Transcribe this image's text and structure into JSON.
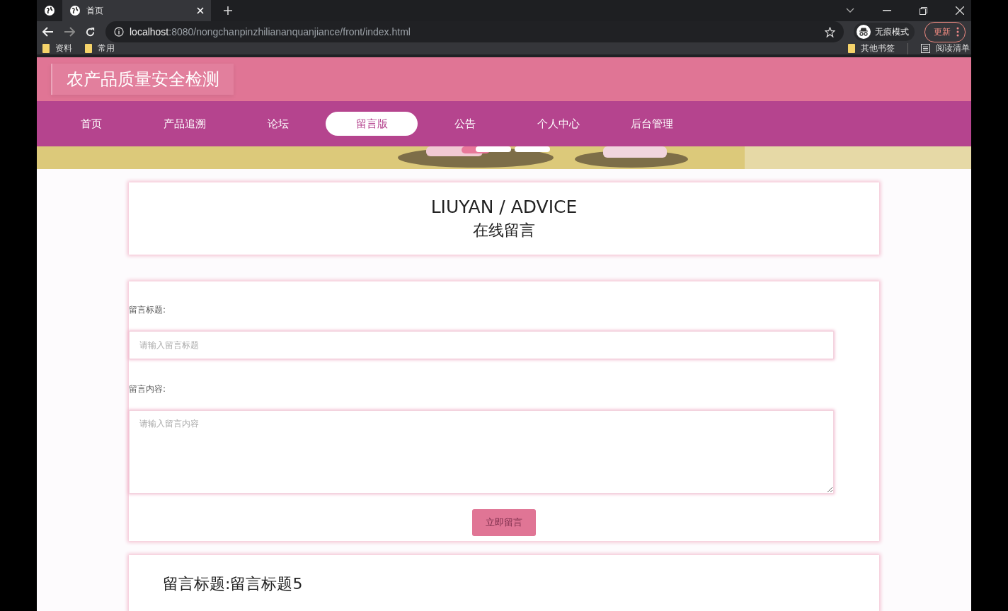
{
  "browser": {
    "tabs": [
      {
        "title": "首页",
        "selected": true
      }
    ],
    "url_host": "localhost",
    "url_path": ":8080/nongchanpinzhiliananquanjiance/front/index.html",
    "incognito_label": "无痕模式",
    "update_label": "更新",
    "bookmarks": [
      "资料",
      "常用"
    ],
    "bookmarks_right": [
      "其他书签",
      "阅读清单"
    ]
  },
  "site": {
    "title": "农产品质量安全检测",
    "nav": [
      {
        "label": "首页",
        "selected": false
      },
      {
        "label": "产品追溯",
        "selected": false
      },
      {
        "label": "论坛",
        "selected": false
      },
      {
        "label": "留言版",
        "selected": true
      },
      {
        "label": "公告",
        "selected": false
      },
      {
        "label": "个人中心",
        "selected": false
      },
      {
        "label": "后台管理",
        "selected": false
      }
    ]
  },
  "heading": {
    "title": "LIUYAN / ADVICE",
    "subtitle": "在线留言"
  },
  "form": {
    "fields": [
      {
        "label": "留言标题:",
        "placeholder": "请输入留言标题",
        "kind": "input"
      },
      {
        "label": "留言内容:",
        "placeholder": "请输入留言内容",
        "kind": "textarea"
      }
    ],
    "submit": "立即留言"
  },
  "messages": [
    {
      "label": "留言标题:",
      "value": "留言标题5"
    }
  ]
}
